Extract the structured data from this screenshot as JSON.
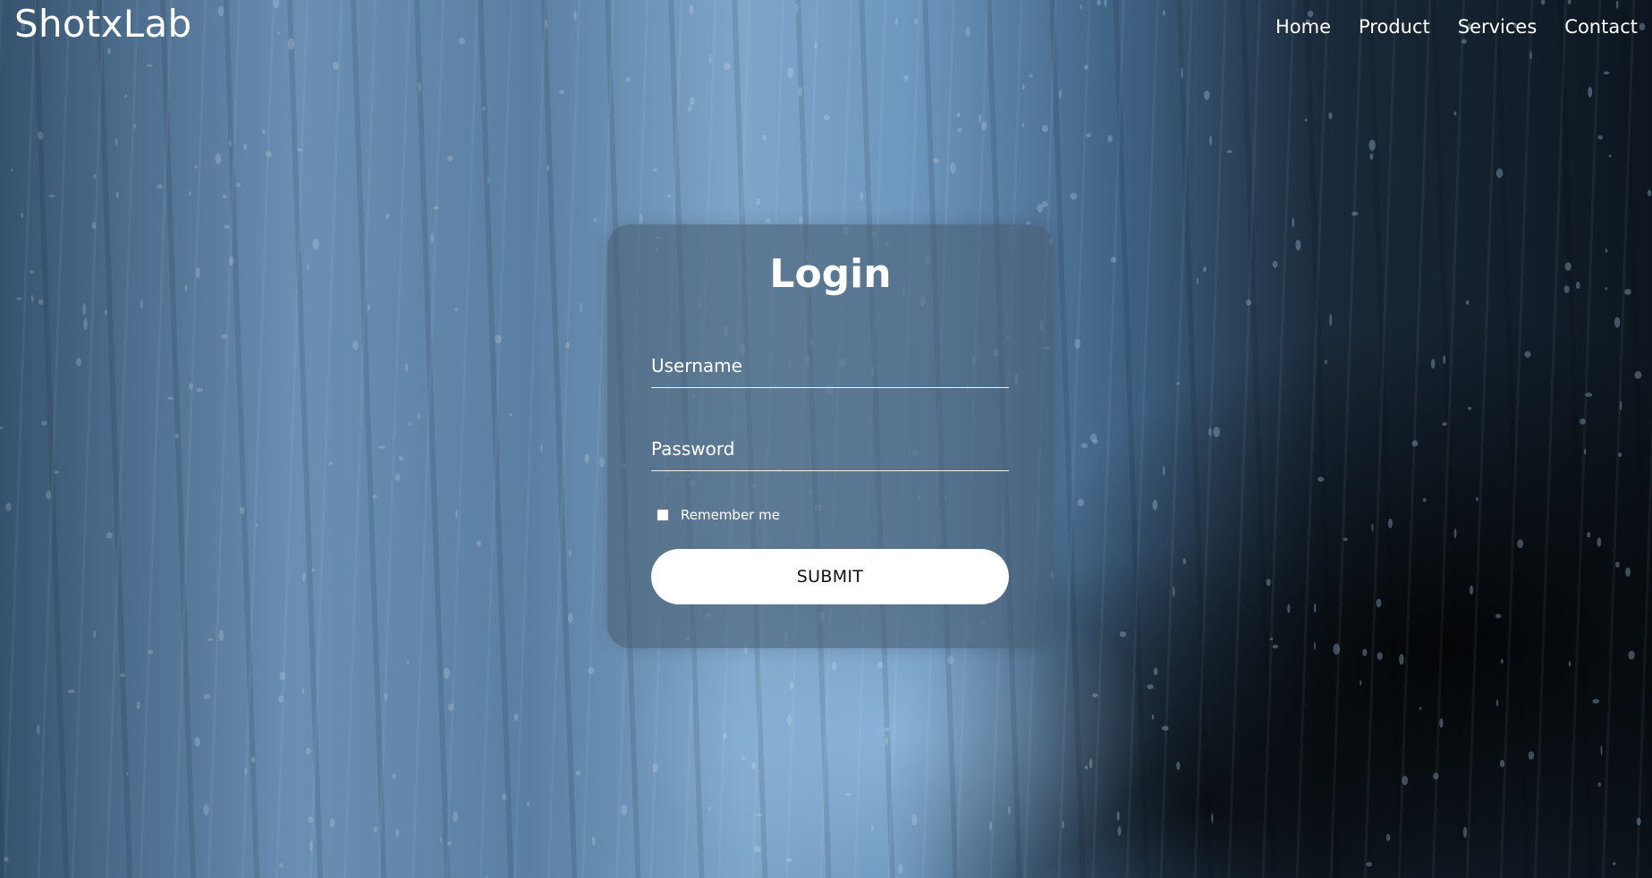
{
  "brand": {
    "name": "ShotxLab"
  },
  "nav": {
    "items": [
      {
        "label": "Home"
      },
      {
        "label": "Product"
      },
      {
        "label": "Services"
      },
      {
        "label": "Contact"
      }
    ]
  },
  "login": {
    "title": "Login",
    "username_placeholder": "Username",
    "password_placeholder": "Password",
    "remember_label": "Remember me",
    "remember_checked": false,
    "submit_label": "SUBMIT"
  },
  "colors": {
    "text": "#ffffff",
    "card": "#465c70",
    "button": "#ffffff",
    "button_text": "#111111"
  },
  "background": {
    "description_icon": "rainy-window-photo"
  }
}
